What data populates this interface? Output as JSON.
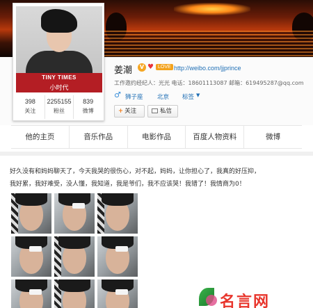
{
  "avatar": {
    "title": "TINY TIMES",
    "subtitle": "小时代"
  },
  "stats": [
    {
      "value": "398",
      "label": "关注"
    },
    {
      "value": "2255155",
      "label": "粉丝"
    },
    {
      "value": "839",
      "label": "微博"
    }
  ],
  "profile": {
    "name": "姜潮",
    "verified_mark": "V",
    "love_badge": "LOVE",
    "url": "http://weibo.com/jjprince",
    "agent_info": "工作邀约经纪人：光光 电话：18601113087 邮箱：619495287@qq.com",
    "gender_symbol": "♂",
    "tags": [
      "狮子座",
      "北京",
      "标签"
    ],
    "follow_label": "关注",
    "message_label": "私信"
  },
  "nav": [
    "他的主页",
    "音乐作品",
    "电影作品",
    "百度人物资料",
    "微博"
  ],
  "post": {
    "line1": "好久没有和妈妈聊天了，今天我哭的很伤心，对不起，妈妈，让你担心了，我真的好压抑，",
    "line2": "我好累，我好难受，没人懂，我知道，我是爷们，我不应该哭！我错了！我情商为0！"
  },
  "watermark": "名言网",
  "colors": {
    "accent_link": "#1f6fb5",
    "avatar_band": "#b41e24",
    "watermark": "#e8352c"
  }
}
